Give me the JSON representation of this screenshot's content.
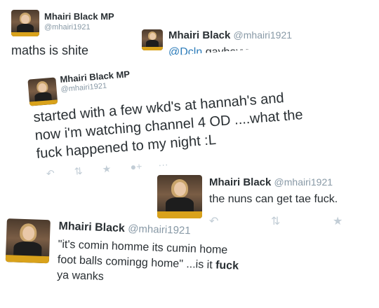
{
  "tweet1": {
    "name": "Mhairi Black MP",
    "handle": "@mhairi1921",
    "text": "maths is shite"
  },
  "tweet2": {
    "name": "Mhairi Black",
    "handle": "@mhairi1921",
    "mention": "@Dcln",
    "text": " gayboyyyyyyyyyyyy :D"
  },
  "tweet3": {
    "name": "Mhairi Black MP",
    "handle": "@mhairi1921",
    "line1": "started with a few wkd's at hannah's and",
    "line2": "now i'm watching channel 4 OD ....what the",
    "line3": "fuck happened to my night :L",
    "actions": [
      "reply-icon",
      "retweet-icon",
      "favorite-icon",
      "follow-icon",
      "more-icon"
    ]
  },
  "tweet4": {
    "name": "Mhairi Black",
    "handle": "@mhairi1921",
    "text": "the nuns can get tae fuck.",
    "actions": [
      "reply-icon",
      "retweet-icon",
      "favorite-icon"
    ]
  },
  "tweet5": {
    "name": "Mhairi Black",
    "handle": "@mhairi1921",
    "line1": "\"it's comin homme its cumin home",
    "line2_start": "foot balls comingg home\" ...is it ",
    "line2_bold": "fuck",
    "line3": "ya wanks"
  },
  "colors": {
    "handle": "#8899a6",
    "mention": "#2b7bb9",
    "action": "#c2cdd6",
    "podium": "#d9a21b"
  }
}
